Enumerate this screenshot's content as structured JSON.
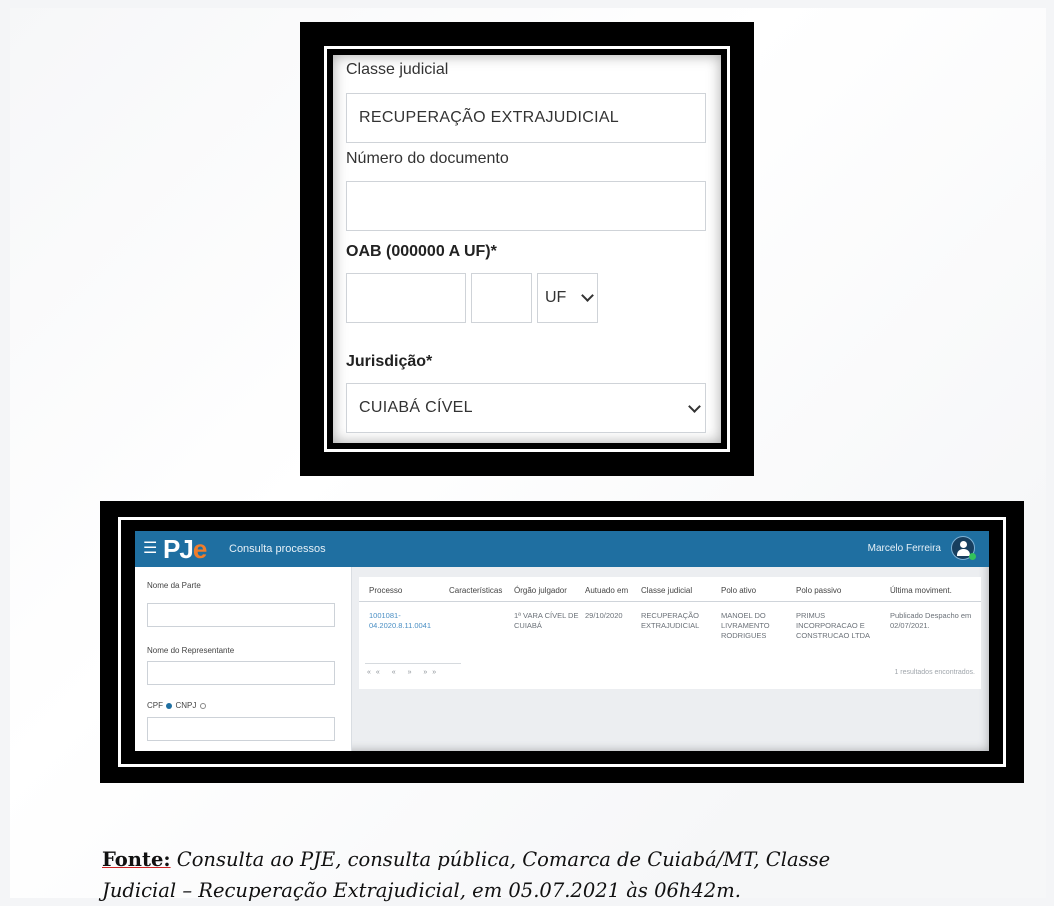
{
  "form": {
    "classe_label": "Classe judicial",
    "classe_value": "RECUPERAÇÃO EXTRAJUDICIAL",
    "numero_label": "Número do documento",
    "numero_value": "",
    "oab_label": "OAB (000000 A UF)*",
    "oab_uf_select": "UF",
    "jurisdicao_label": "Jurisdição*",
    "jurisdicao_value": "CUIABÁ CÍVEL"
  },
  "pje": {
    "logo_main": "PJ",
    "logo_e": "e",
    "title": "Consulta processos",
    "user": "Marcelo Ferreira",
    "menu_icon": "hamburger-icon",
    "sidebar": {
      "nome_parte_label": "Nome da Parte",
      "nome_representante_label": "Nome do Representante",
      "cpf_label": "CPF",
      "cnpj_label": "CNPJ"
    },
    "table": {
      "headers": [
        "Processo",
        "Características",
        "Órgão julgador",
        "Autuado em",
        "Classe judicial",
        "Polo ativo",
        "Polo passivo",
        "Última moviment."
      ],
      "row": {
        "processo": "1001081-04.2020.8.11.0041",
        "caracteristicas": "",
        "orgao": "1ª VARA CÍVEL DE CUIABÁ",
        "autuado": "29/10/2020",
        "classe": "RECUPERAÇÃO EXTRAJUDICIAL",
        "polo_ativo": "MANOEL DO LIVRAMENTO RODRIGUES",
        "polo_passivo": "PRIMUS INCORPORACAO E CONSTRUCAO LTDA",
        "ultima": "Publicado Despacho em 02/07/2021."
      },
      "pagination": "«« « » »»",
      "result_count": "1 resultados encontrados."
    }
  },
  "caption": {
    "fonte": "Fonte:",
    "text_line1": " Consulta ao PJE, consulta pública, Comarca de Cuiabá/MT, Classe",
    "text_line2": "Judicial – Recuperação Extrajudicial, em 05.07.2021 às 06h42m."
  }
}
